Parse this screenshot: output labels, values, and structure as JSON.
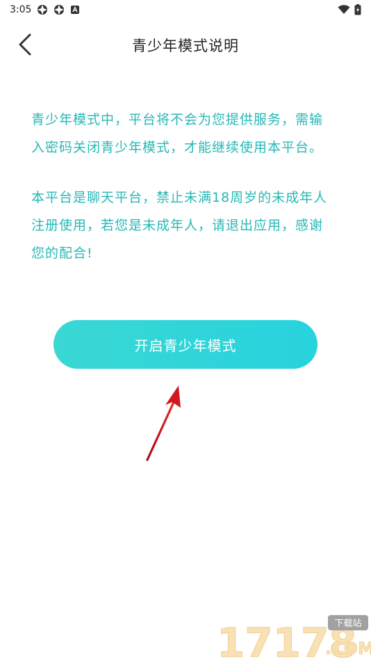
{
  "status_bar": {
    "time": "3:05",
    "left_icons": [
      "app-icon",
      "app-icon",
      "app-icon"
    ],
    "right_icons": [
      "wifi-icon",
      "battery-icon"
    ]
  },
  "header": {
    "back_icon": "chevron-left-icon",
    "title": "青少年模式说明"
  },
  "content": {
    "paragraph_1_line_1": "青少年模式中，平台将不会为您提供服务，需输",
    "paragraph_1_line_2": "入密码关闭青少年模式，才能继续使用本平台。",
    "paragraph_2_line_1": "本平台是聊天平台，禁止未满18周岁的未成年人",
    "paragraph_2_line_2": "注册使用，若您是未成年人，请退出应用，感谢",
    "paragraph_2_line_3": "您的配合!"
  },
  "button": {
    "label": "开启青少年模式"
  },
  "colors": {
    "accent_text": "#26b8b6",
    "button_gradient_start": "#3ad7d3",
    "button_gradient_end": "#27d3de",
    "annotation_arrow": "#d0181e"
  },
  "watermark": {
    "text": "17178.COM",
    "badge": "下载站"
  }
}
